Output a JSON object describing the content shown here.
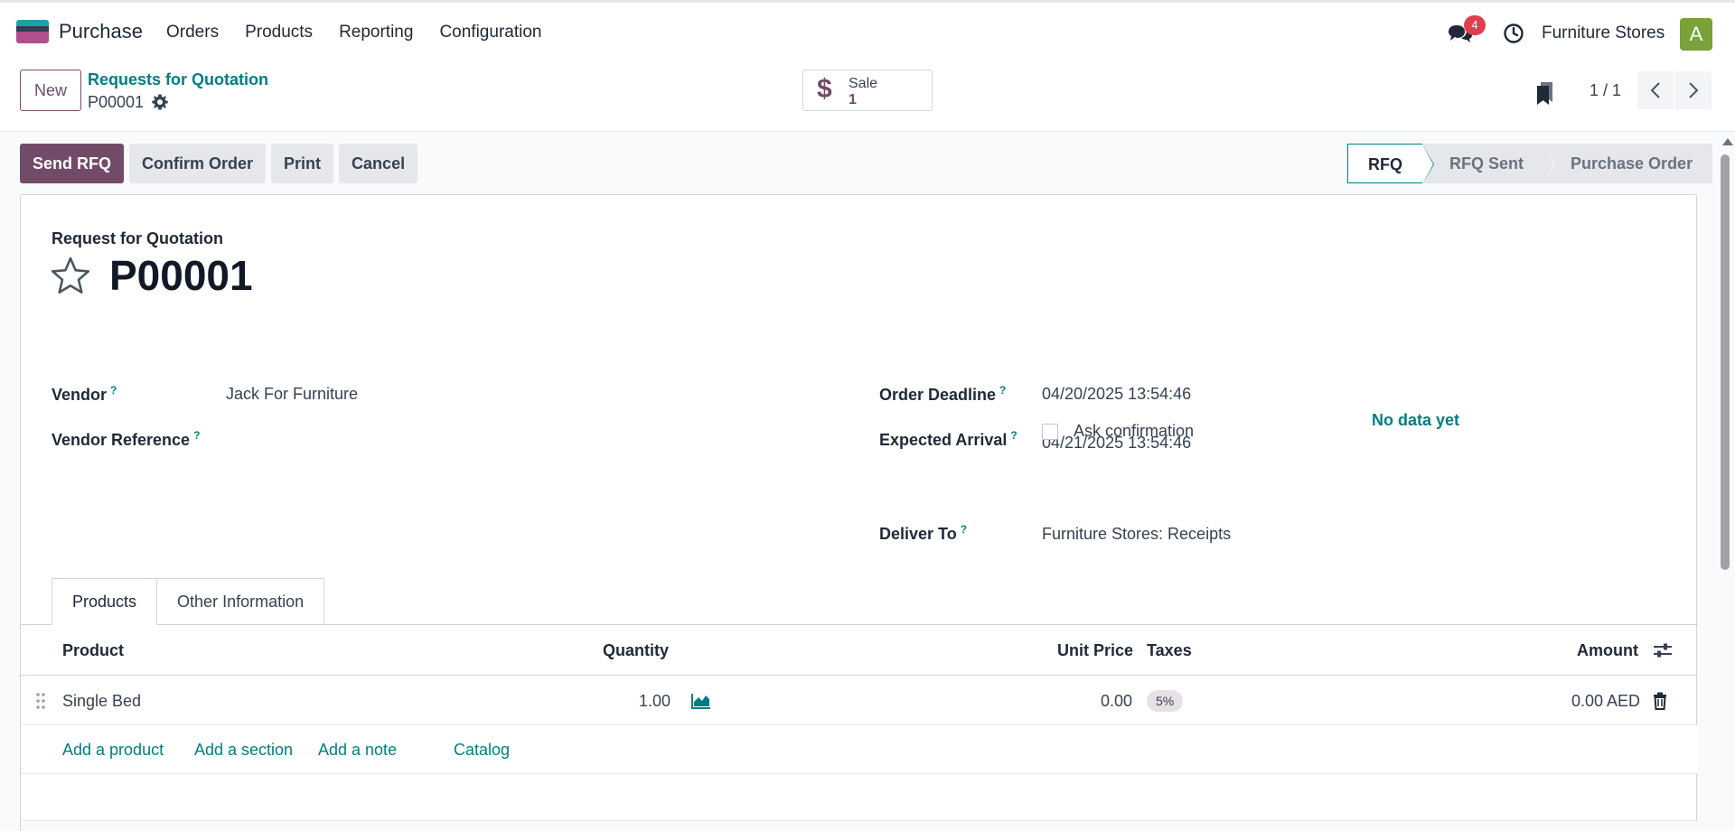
{
  "navbar": {
    "app_name": "Purchase",
    "menu": [
      "Orders",
      "Products",
      "Reporting",
      "Configuration"
    ],
    "chat_count": "4",
    "company": "Furniture Stores",
    "avatar_letter": "A"
  },
  "control": {
    "new_label": "New",
    "breadcrumb": "Requests for Quotation",
    "record": "P00001",
    "smart_button": {
      "label": "Sale",
      "value": "1"
    },
    "pager": "1 / 1"
  },
  "statusbar": {
    "buttons": [
      "Send RFQ",
      "Confirm Order",
      "Print",
      "Cancel"
    ],
    "stages": [
      "RFQ",
      "RFQ Sent",
      "Purchase Order"
    ],
    "active_stage": "RFQ"
  },
  "form": {
    "subtitle": "Request for Quotation",
    "title": "P00001",
    "vendor_label": "Vendor",
    "vendor": "Jack For Furniture",
    "vendor_ref_label": "Vendor Reference",
    "vendor_ref": "",
    "deadline_label": "Order Deadline",
    "deadline": "04/20/2025 13:54:46",
    "arrival_label": "Expected Arrival",
    "arrival": "04/21/2025 13:54:46",
    "no_data": "No data yet",
    "ask_confirmation": "Ask confirmation",
    "deliver_label": "Deliver To",
    "deliver": "Furniture Stores: Receipts",
    "help_mark": "?"
  },
  "tabs": [
    "Products",
    "Other Information"
  ],
  "table": {
    "headers": {
      "product": "Product",
      "quantity": "Quantity",
      "unit_price": "Unit Price",
      "taxes": "Taxes",
      "amount": "Amount"
    },
    "rows": [
      {
        "product": "Single Bed",
        "quantity": "1.00",
        "unit_price": "0.00",
        "taxes": "5%",
        "amount": "0.00 AED"
      }
    ],
    "add_links": [
      "Add a product",
      "Add a section",
      "Add a note",
      "Catalog"
    ]
  },
  "colors": {
    "primary": "#714b67",
    "accent": "#017e84",
    "badge": "#e03e4f"
  }
}
